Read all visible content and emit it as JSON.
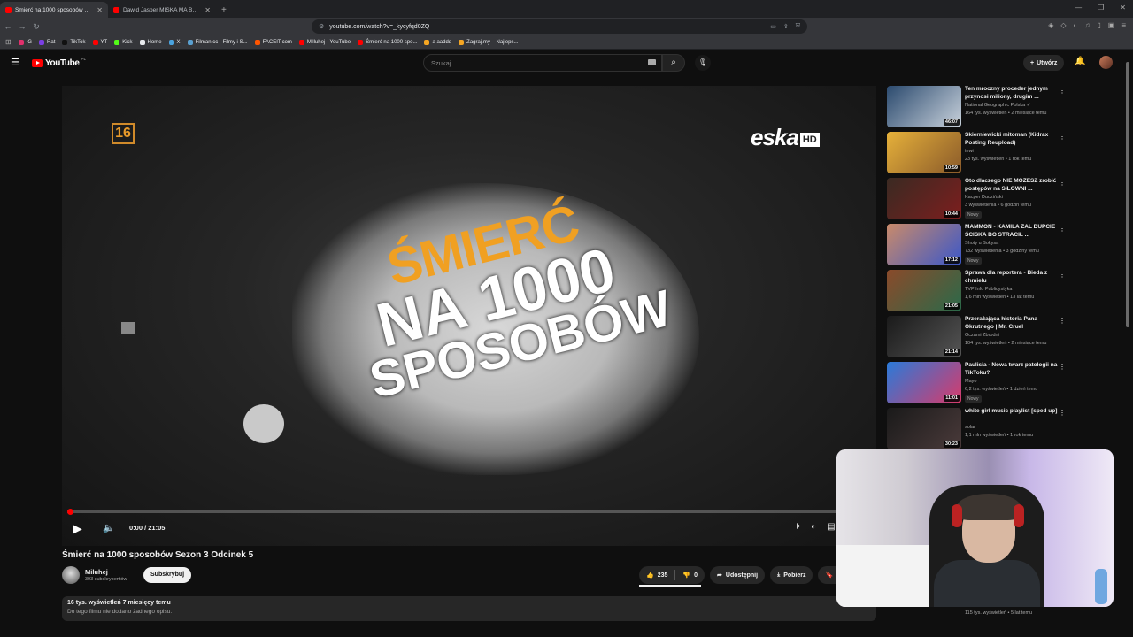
{
  "browser": {
    "tabs": [
      {
        "title": "Śmierć na 1000 sposobów Sezon",
        "active": true
      },
      {
        "title": "Dawid Jasper MIŚKA MA BZIKA - Yo",
        "active": false
      }
    ],
    "url": "youtube.com/watch?v=_kycyfqd0ZQ",
    "bookmarks": [
      {
        "label": "IG",
        "color": "#e1306c"
      },
      {
        "label": "Rat",
        "color": "#7b3fe4"
      },
      {
        "label": "TikTok",
        "color": "#111111"
      },
      {
        "label": "YT",
        "color": "#ff0000"
      },
      {
        "label": "Kick",
        "color": "#53fc18"
      },
      {
        "label": "Home",
        "color": "#e8eaed"
      },
      {
        "label": "X",
        "color": "#4aa3df"
      },
      {
        "label": "Filman.cc - Filmy i S...",
        "color": "#5aa0d0"
      },
      {
        "label": "FACEIT.com",
        "color": "#ff5500"
      },
      {
        "label": "Milluhej - YouTube",
        "color": "#ff0000"
      },
      {
        "label": "Śmierć na 1000 spo...",
        "color": "#ff0000"
      },
      {
        "label": "a aaddd",
        "color": "#f5a623"
      },
      {
        "label": "Zagraj.my – Najleps...",
        "color": "#f5a623"
      }
    ]
  },
  "header": {
    "logo": "YouTube",
    "country": "PL",
    "search_placeholder": "Szukaj",
    "create_label": "Utwórz"
  },
  "player": {
    "age_rating": "16",
    "channel_logo": "eska",
    "channel_logo_suffix": "HD",
    "title_art": [
      "ŚMIERĆ",
      "NA 1000",
      "SPOSOBÓW"
    ],
    "time": "0:00 / 21:05",
    "progress_fraction": 0.0
  },
  "video": {
    "title": "Śmierć na 1000 sposobów Sezon 3 Odcinek 5",
    "channel": "Miluhej",
    "subscribers": "393 subskrybentów",
    "subscribe_label": "Subskrybuj",
    "likes": "235",
    "dislikes": "0",
    "share_label": "Udostępnij",
    "download_label": "Pobierz",
    "save_label": "Za",
    "stats": "16 tys. wyświetleń  7 miesięcy temu",
    "description": "Do tego filmu nie dodano żadnego opisu."
  },
  "recommendations": [
    {
      "title": "Ten mroczny proceder jednym przynosi miliony, drugim ...",
      "channel": "National Geographic Polska ✓",
      "meta": "164 tys. wyświetleń • 2 miesiące temu",
      "duration": "46:07",
      "new": "",
      "colors": [
        "#2b4a6e",
        "#c9d2dc"
      ]
    },
    {
      "title": "Skierniewicki mitoman (Kidrax Posting Reupload)",
      "channel": "tewi",
      "meta": "23 tys. wyświetleń • 1 rok temu",
      "duration": "10:59",
      "new": "",
      "colors": [
        "#e6b13a",
        "#8a5a2a"
      ]
    },
    {
      "title": "Oto dlaczego NIE MOŻESZ zrobić postępów na SIŁOWNI ...",
      "channel": "Kacper Dudziński",
      "meta": "3 wyświetlenia • 6 godzin temu",
      "duration": "10:44",
      "new": "Nowy",
      "colors": [
        "#3a2a22",
        "#7d1e1e"
      ]
    },
    {
      "title": "MAMMON - KAMILA ŻAL DUPCIE ŚCISKA BO STRACIŁ ...",
      "channel": "Shoty u Sołtysa",
      "meta": "732 wyświetlenia • 3 godziny temu",
      "duration": "17:12",
      "new": "Nowy",
      "colors": [
        "#c98a6a",
        "#3a57c9"
      ]
    },
    {
      "title": "Sprawa dla reportera - Bieda z chmielu",
      "channel": "TVP Info Publicystyka",
      "meta": "1,6 mln wyświetleń • 13 lat temu",
      "duration": "21:05",
      "new": "",
      "colors": [
        "#8a4a2a",
        "#2a6a4a"
      ]
    },
    {
      "title": "Przerażająca historia Pana Okrutnego | Mr. Cruel",
      "channel": "Oczami Zbrodni",
      "meta": "104 tys. wyświetleń • 2 miesiące temu",
      "duration": "21:14",
      "new": "",
      "colors": [
        "#1a1a1a",
        "#555555"
      ]
    },
    {
      "title": "Paulisia - Nowa twarz patologii na TikToku?",
      "channel": "Mayo",
      "meta": "6,2 tys. wyświetleń • 1 dzień temu",
      "duration": "11:01",
      "new": "Nowy",
      "colors": [
        "#2a7ad9",
        "#d93a6a"
      ]
    },
    {
      "title": "white girl music playlist [sped up]",
      "channel": "solar",
      "meta": "1,1 mln wyświetleń • 1 rok temu",
      "duration": "30:23",
      "new": "",
      "colors": [
        "#1a1a1a",
        "#4a3a3a"
      ]
    }
  ],
  "partial_rec_meta": "115 tys. wyświetleń • 5 lat temu"
}
